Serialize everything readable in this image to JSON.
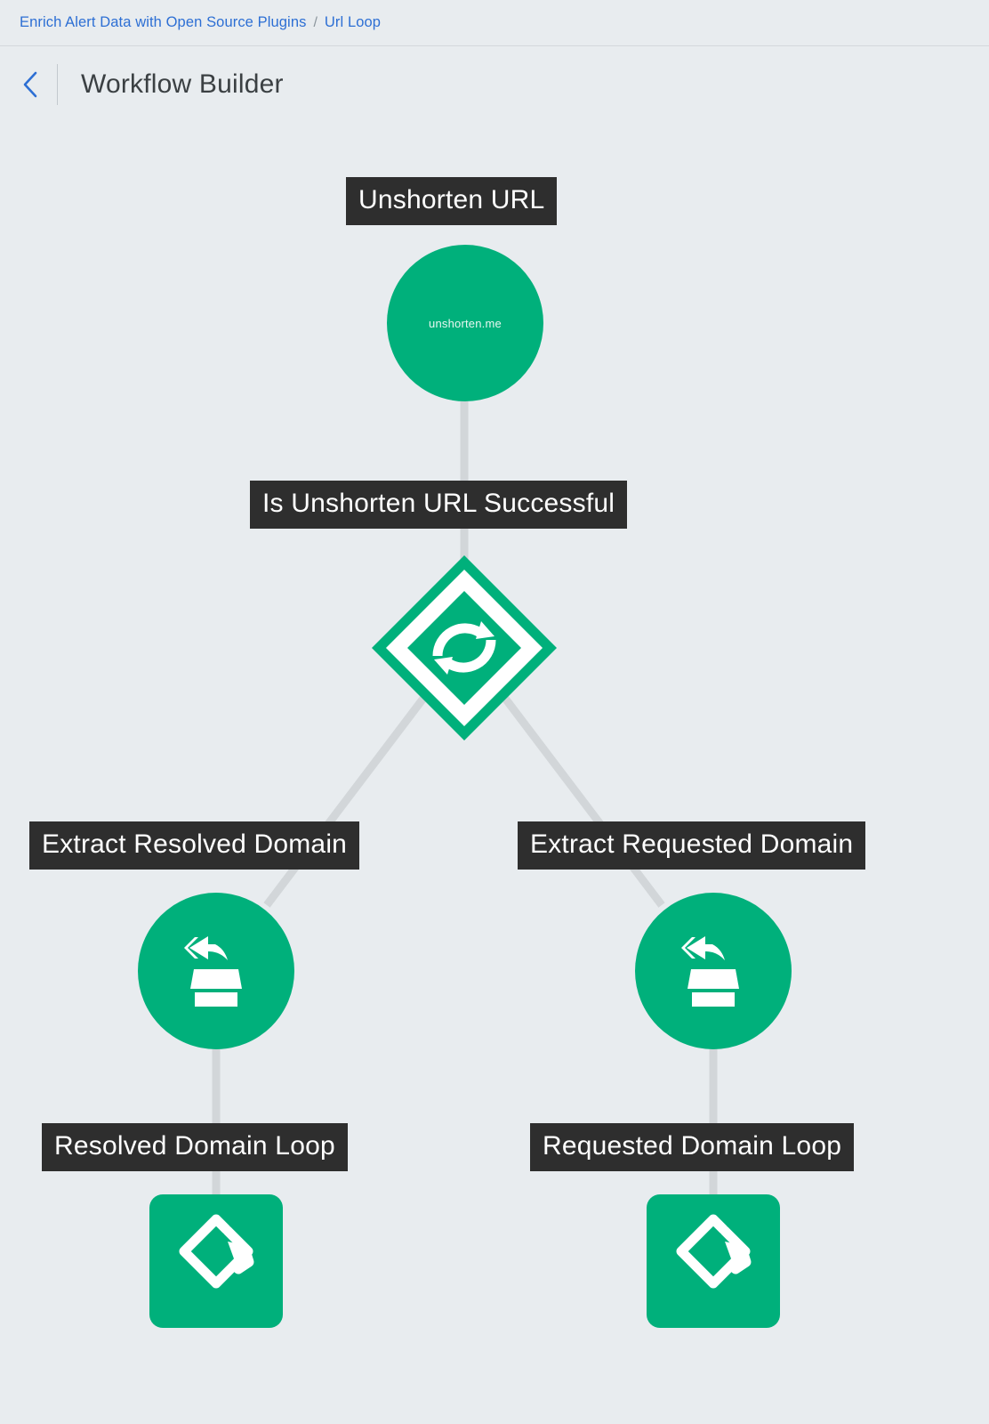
{
  "breadcrumb": {
    "items": [
      {
        "label": "Enrich Alert Data with Open Source Plugins"
      },
      {
        "label": "Url Loop"
      }
    ],
    "separator": "/"
  },
  "header": {
    "back_icon": "chevron-left-icon",
    "title": "Workflow Builder"
  },
  "theme": {
    "background": "#e8ecef",
    "node_green": "#00b07b",
    "label_dark": "#2e2e2e",
    "label_text": "#ffffff",
    "edge_grey": "#d2d6d9",
    "link_blue": "#2d6fd4"
  },
  "workflow": {
    "nodes": [
      {
        "id": "unshorten-url",
        "label": "Unshorten URL",
        "shape": "circle",
        "caption": "unshorten.me",
        "icon": "none"
      },
      {
        "id": "is-unshorten-url-successful",
        "label": "Is Unshorten URL Successful",
        "shape": "diamond",
        "caption": "",
        "icon": "sync-arrows-icon"
      },
      {
        "id": "extract-resolved-domain",
        "label": "Extract Resolved Domain",
        "shape": "circle",
        "caption": "",
        "icon": "extract-from-box-icon"
      },
      {
        "id": "extract-requested-domain",
        "label": "Extract Requested Domain",
        "shape": "circle",
        "caption": "",
        "icon": "extract-from-box-icon"
      },
      {
        "id": "resolved-domain-loop",
        "label": "Resolved Domain Loop",
        "shape": "rounded-square",
        "caption": "",
        "icon": "loop-icon"
      },
      {
        "id": "requested-domain-loop",
        "label": "Requested Domain Loop",
        "shape": "rounded-square",
        "caption": "",
        "icon": "loop-icon"
      }
    ],
    "edges": [
      {
        "from": "unshorten-url",
        "to": "is-unshorten-url-successful"
      },
      {
        "from": "is-unshorten-url-successful",
        "to": "extract-resolved-domain"
      },
      {
        "from": "is-unshorten-url-successful",
        "to": "extract-requested-domain"
      },
      {
        "from": "extract-resolved-domain",
        "to": "resolved-domain-loop"
      },
      {
        "from": "extract-requested-domain",
        "to": "requested-domain-loop"
      }
    ]
  }
}
